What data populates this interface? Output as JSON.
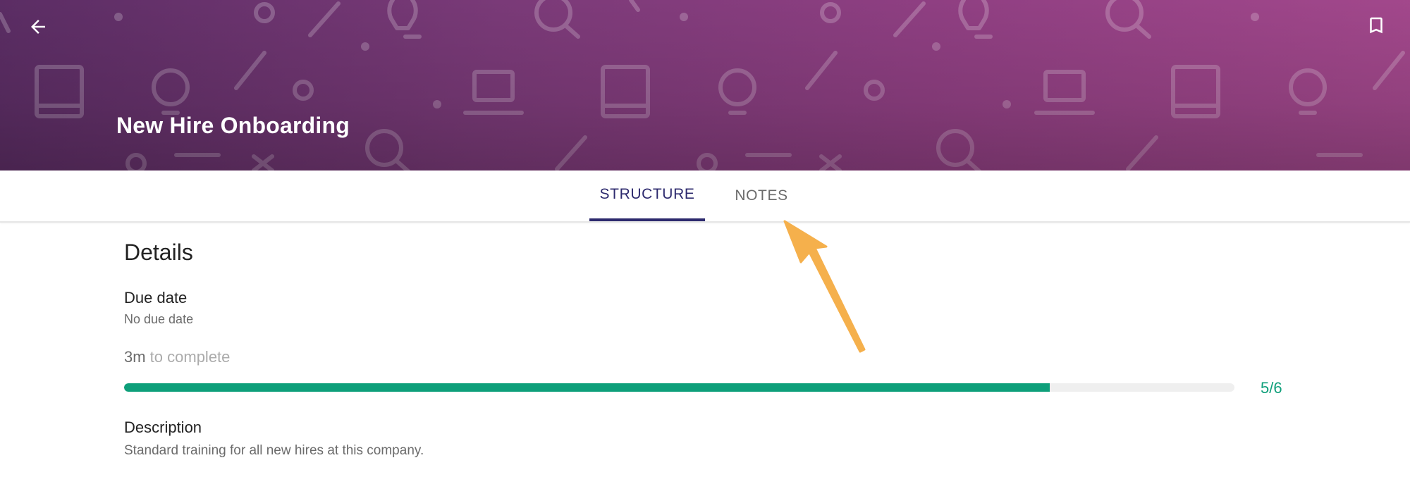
{
  "header": {
    "title": "New Hire Onboarding",
    "back_icon": "arrow-back-icon",
    "bookmark_icon": "bookmark-icon",
    "colors": {
      "gradient_start": "#5b2d64",
      "gradient_end": "#a3488c",
      "title_text": "#ffffff"
    }
  },
  "tabs": [
    {
      "label": "STRUCTURE",
      "active": true
    },
    {
      "label": "NOTES",
      "active": false
    }
  ],
  "details": {
    "heading": "Details",
    "due_date_label": "Due date",
    "due_date_value": "No due date",
    "time_value": "3m",
    "time_suffix": " to complete",
    "progress": {
      "completed": 5,
      "total": 6,
      "label": "5/6",
      "color": "#0e9f7a"
    },
    "description_label": "Description",
    "description_value": "Standard training for all new hires at this company."
  },
  "annotation": {
    "color": "#f5b04c",
    "icon": "pointer-arrow-icon"
  }
}
